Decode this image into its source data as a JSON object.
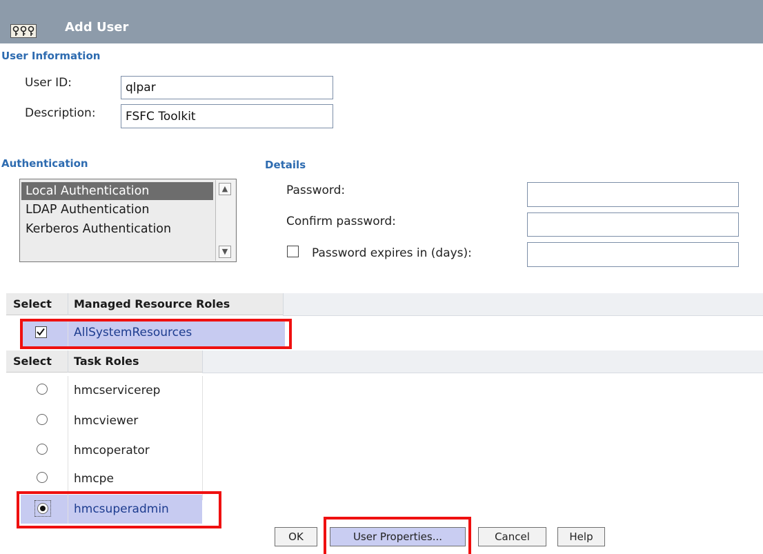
{
  "window": {
    "title": "Add User",
    "icon": "keys-icon"
  },
  "user_info": {
    "heading": "User Information",
    "user_id_label": "User ID:",
    "user_id_value": "qlpar",
    "description_label": "Description:",
    "description_value": "FSFC Toolkit"
  },
  "authentication": {
    "heading": "Authentication",
    "options": [
      "Local Authentication",
      "LDAP Authentication",
      "Kerberos Authentication"
    ],
    "selected": "Local Authentication"
  },
  "details": {
    "heading": "Details",
    "password_label": "Password:",
    "confirm_label": "Confirm password:",
    "expires_label": "Password expires in (days):",
    "expires_checked": false
  },
  "managed_resource_roles": {
    "headers": [
      "Select",
      "Managed Resource Roles"
    ],
    "rows": [
      {
        "name": "AllSystemResources",
        "checked": true
      }
    ]
  },
  "task_roles": {
    "headers": [
      "Select",
      "Task Roles"
    ],
    "rows": [
      {
        "name": "hmcservicerep",
        "selected": false
      },
      {
        "name": "hmcviewer",
        "selected": false
      },
      {
        "name": "hmcoperator",
        "selected": false
      },
      {
        "name": "hmcpe",
        "selected": false
      },
      {
        "name": "hmcsuperadmin",
        "selected": true
      }
    ]
  },
  "buttons": {
    "ok": "OK",
    "user_properties": "User Properties...",
    "cancel": "Cancel",
    "help": "Help"
  },
  "colors": {
    "highlight": "#ef1010",
    "section_heading": "#2d6bb0",
    "titlebar": "#8d9baa",
    "selected_row": "#c7cbf1"
  }
}
